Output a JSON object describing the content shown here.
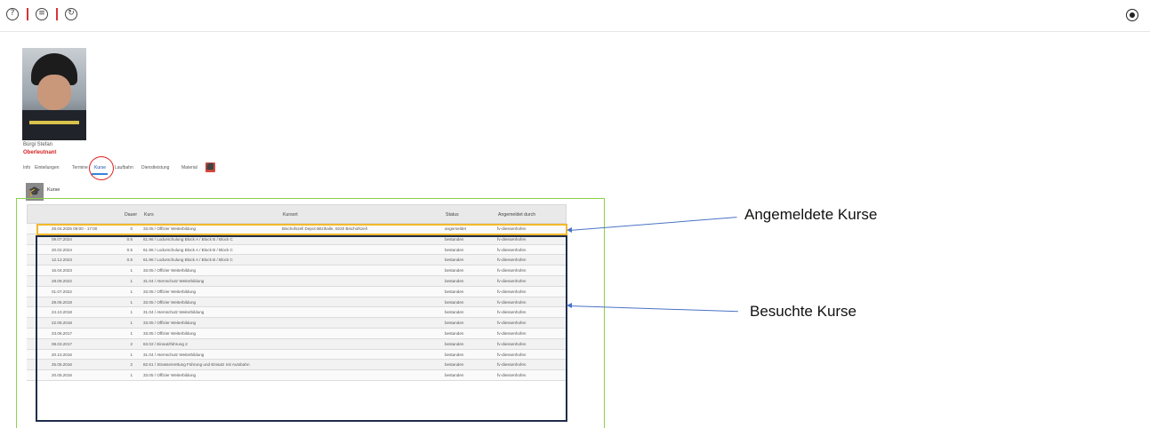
{
  "toolbar": {
    "help_icon": "?",
    "list_icon": "≡",
    "refresh_icon": "↻"
  },
  "profile": {
    "name": "Bürgi Stefan",
    "rank": "Oberleutnant"
  },
  "tabs": [
    {
      "label": "Info"
    },
    {
      "label": "Einteilungen"
    },
    {
      "label": "Termine"
    },
    {
      "label": "Kurse"
    },
    {
      "label": "Laufbahn"
    },
    {
      "label": "Dienstleistung"
    },
    {
      "label": "Material"
    }
  ],
  "section": {
    "title": "Kurse"
  },
  "table": {
    "headers": {
      "dauer": "Dauer",
      "kurs": "Kurs",
      "kursort": "Kursort",
      "status": "Status",
      "angemeldet_durch": "Angemeldet durch"
    },
    "rows": [
      {
        "date": "26.04.2025 08:00 - 17:00",
        "dauer": "0",
        "kurs": "33.05 / Offizier Weiterbildung",
        "kursort": "Bischofszell Depot Bitzihalle, 9220 Bischofszell",
        "status": "angemeldet",
        "by": "fv-diessenhofen"
      },
      {
        "date": "09.07.2024",
        "dauer": "0.5",
        "kurs": "61.96 / Lodurschulung Block A / Block B / Block C",
        "kursort": "",
        "status": "bestanden",
        "by": "fv-diessenhofen"
      },
      {
        "date": "20.02.2024",
        "dauer": "0.5",
        "kurs": "61.96 / Lodurschulung Block A / Block B / Block C",
        "kursort": "",
        "status": "bestanden",
        "by": "fv-diessenhofen"
      },
      {
        "date": "12.12.2023",
        "dauer": "0.5",
        "kurs": "61.96 / Lodurschulung Block A / Block B / Block C",
        "kursort": "",
        "status": "bestanden",
        "by": "fv-diessenhofen"
      },
      {
        "date": "15.04.2023",
        "dauer": "1",
        "kurs": "33.05 / Offizier Weiterbildung",
        "kursort": "",
        "status": "bestanden",
        "by": "fv-diessenhofen"
      },
      {
        "date": "28.09.2022",
        "dauer": "1",
        "kurs": "31.04 / Atemschutz Weiterbildung",
        "kursort": "",
        "status": "bestanden",
        "by": "fv-diessenhofen"
      },
      {
        "date": "01.07.2022",
        "dauer": "1",
        "kurs": "33.05 / Offizier Weiterbildung",
        "kursort": "",
        "status": "bestanden",
        "by": "fv-diessenhofen"
      },
      {
        "date": "28.06.2019",
        "dauer": "1",
        "kurs": "33.05 / Offizier Weiterbildung",
        "kursort": "",
        "status": "bestanden",
        "by": "fv-diessenhofen"
      },
      {
        "date": "24.10.2018",
        "dauer": "1",
        "kurs": "31.04 / Atemschutz Weiterbildung",
        "kursort": "",
        "status": "bestanden",
        "by": "fv-diessenhofen"
      },
      {
        "date": "22.06.2018",
        "dauer": "1",
        "kurs": "33.05 / Offizier Weiterbildung",
        "kursort": "",
        "status": "bestanden",
        "by": "fv-diessenhofen"
      },
      {
        "date": "23.06.2017",
        "dauer": "1",
        "kurs": "33.05 / Offizier Weiterbildung",
        "kursort": "",
        "status": "bestanden",
        "by": "fv-diessenhofen"
      },
      {
        "date": "08.03.2017",
        "dauer": "2",
        "kurs": "63.02 / Einsatzführung 2",
        "kursort": "",
        "status": "bestanden",
        "by": "fv-diessenhofen"
      },
      {
        "date": "20.10.2016",
        "dauer": "1",
        "kurs": "31.04 / Atemschutz Weiterbildung",
        "kursort": "",
        "status": "bestanden",
        "by": "fv-diessenhofen"
      },
      {
        "date": "25.05.2016",
        "dauer": "2",
        "kurs": "82.61 / Strassenrettung Führung und Einsatz mit Autobahn",
        "kursort": "",
        "status": "bestanden",
        "by": "fv-diessenhofen"
      },
      {
        "date": "20.05.2016",
        "dauer": "1",
        "kurs": "33.05 / Offizier Weiterbildung",
        "kursort": "",
        "status": "bestanden",
        "by": "fv-diessenhofen"
      }
    ]
  },
  "callouts": {
    "registered": "Angemeldete Kurse",
    "attended": "Besuchte Kurse"
  },
  "colors": {
    "rank_red": "#d42020",
    "highlight_yellow": "#f4b82a",
    "highlight_navy": "#1f2d4a",
    "frame_green": "#8bd24a",
    "arrow_blue": "#4a72c4"
  }
}
